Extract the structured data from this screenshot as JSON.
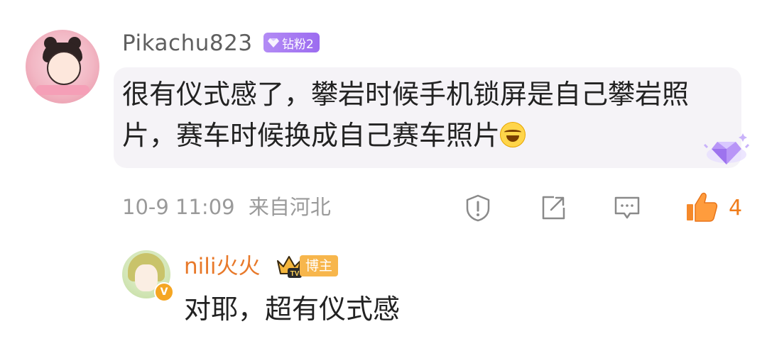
{
  "comment": {
    "username": "Pikachu823",
    "badge": "钻粉2",
    "text": "很有仪式感了，攀岩时候手机锁屏是自己攀岩照片，赛车时候换成自己赛车照片",
    "emoji": "laughing-tears-emoji",
    "time": "10-9 11:09",
    "location": "来自河北",
    "like_count": "4"
  },
  "reply": {
    "username": "nili火火",
    "badge": "博主",
    "text": "对耶，超有仪式感"
  },
  "colors": {
    "accent_orange": "#f07d1b",
    "badge_purple": "#a77af2",
    "badge_gold": "#f7b64c",
    "meta_gray": "#9a9a9a"
  }
}
